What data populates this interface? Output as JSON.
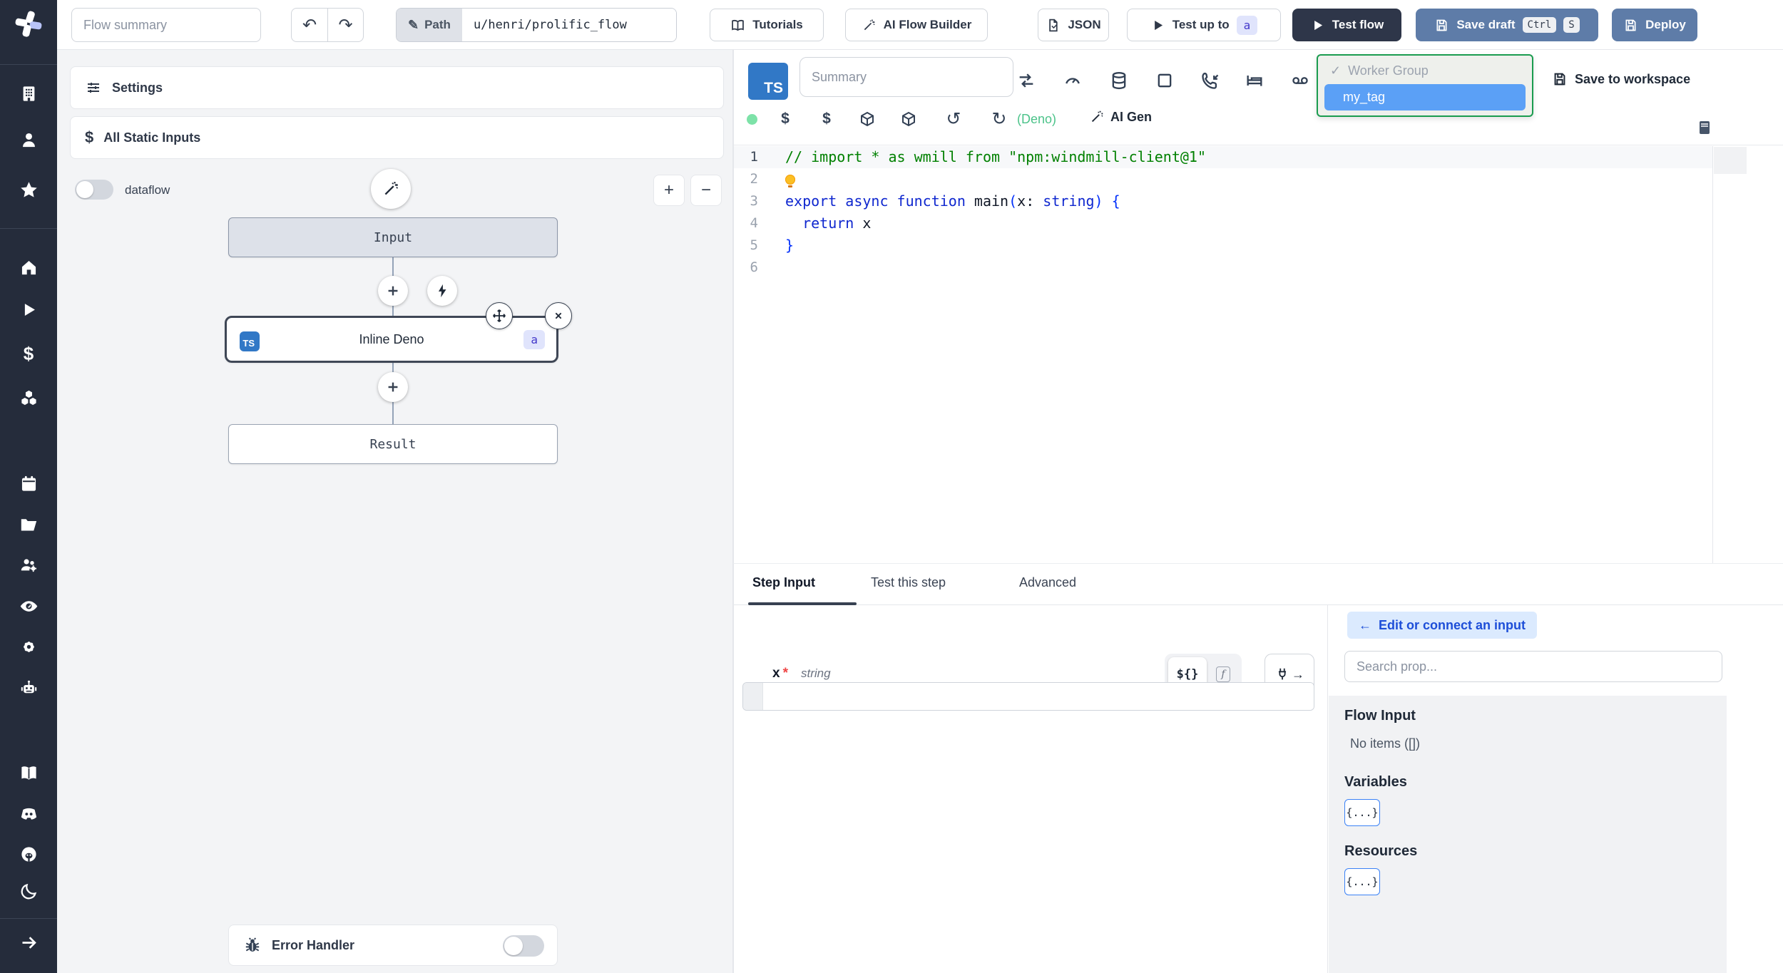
{
  "topbar": {
    "flow_summary_placeholder": "Flow summary",
    "undo_icon": "undo-arrow",
    "redo_icon": "redo-arrow",
    "path_label": "Path",
    "path_value": "u/henri/prolific_flow",
    "tutorials_label": "Tutorials",
    "ai_flow_builder_label": "AI Flow Builder",
    "json_label": "JSON",
    "test_up_to_label": "Test up to",
    "test_up_to_badge": "a",
    "test_flow_label": "Test flow",
    "save_draft_label": "Save draft",
    "save_draft_kbd": [
      "Ctrl",
      "S"
    ],
    "deploy_label": "Deploy"
  },
  "sidebar": {
    "icons": [
      "windmill-logo",
      "building",
      "user",
      "star",
      "home",
      "play",
      "dollar",
      "cubes",
      "calendar",
      "folder",
      "users-settings",
      "eye",
      "gear",
      "robot",
      "book",
      "discord",
      "github",
      "moon",
      "arrow-right"
    ]
  },
  "flow_panel": {
    "settings_label": "Settings",
    "all_static_inputs_label": "All Static Inputs",
    "dataflow_label": "dataflow",
    "dataflow_on": false,
    "zoom_in": "+",
    "zoom_out": "−",
    "graph": {
      "input_node": "Input",
      "step_node": "Inline Deno",
      "step_lang_badge": "TS",
      "step_id_badge": "a",
      "result_node": "Result"
    },
    "error_handler_label": "Error Handler",
    "error_handler_on": false
  },
  "editor": {
    "lang_badge": "TS",
    "summary_placeholder": "Summary",
    "toolbar_icons": [
      "retry",
      "concurrency-gauge",
      "cache-database",
      "early-stop-square",
      "suspend-phone",
      "sleep-bed",
      "mock-pipe"
    ],
    "status_dot_color": "#7de2a8",
    "second_row_icons": [
      "path-dollar",
      "variable-dollar",
      "package",
      "package",
      "history",
      "reload"
    ],
    "deno_label": "(Deno)",
    "deno_color": "#4cc38a",
    "ai_gen_label": "AI Gen",
    "worker_group": {
      "check": "✓",
      "header": "Worker Group",
      "selected": "my_tag",
      "selected_bg": "#5ba0f6",
      "border": "#1a9c4f"
    },
    "save_to_workspace_label": "Save to workspace",
    "code": {
      "lines": [
        {
          "n": "1",
          "active": true,
          "tokens": [
            {
              "t": "// import * as wmill from \"npm:windmill-client@1\"",
              "c": "cmt"
            }
          ]
        },
        {
          "n": "2",
          "tokens": [
            {
              "c": "bulb"
            }
          ]
        },
        {
          "n": "3",
          "tokens": [
            {
              "t": "export ",
              "c": "kw"
            },
            {
              "t": "async ",
              "c": "kw"
            },
            {
              "t": "function ",
              "c": "kw"
            },
            {
              "t": "main",
              "c": "fn"
            },
            {
              "t": "(",
              "c": "br"
            },
            {
              "t": "x",
              "c": "pm"
            },
            {
              "t": ": ",
              "c": "pl"
            },
            {
              "t": "string",
              "c": "kw"
            },
            {
              "t": ")",
              "c": "br"
            },
            {
              "t": " {",
              "c": "br"
            }
          ]
        },
        {
          "n": "4",
          "tokens": [
            {
              "t": "  ",
              "c": "pl"
            },
            {
              "t": "return",
              "c": "kw"
            },
            {
              "t": " x",
              "c": "pl"
            }
          ]
        },
        {
          "n": "5",
          "tokens": [
            {
              "t": "}",
              "c": "br"
            }
          ]
        },
        {
          "n": "6",
          "tokens": []
        }
      ]
    }
  },
  "bottom": {
    "tabs": [
      {
        "label": "Step Input",
        "active": true
      },
      {
        "label": "Test this step",
        "active": false
      },
      {
        "label": "Advanced",
        "active": false
      }
    ],
    "field": {
      "name": "x",
      "required_mark": "*",
      "type": "string",
      "value": ""
    },
    "expr_toggle_label": "${}",
    "fn_toggle_label": "f",
    "plug_arrow": "→",
    "picker": {
      "back_arrow": "←",
      "edit_connect_label": "Edit or connect an input",
      "search_placeholder": "Search prop...",
      "flow_input_label": "Flow Input",
      "no_items_label": "No items ([])",
      "variables_label": "Variables",
      "resources_label": "Resources",
      "braces_chip": "{...}"
    }
  }
}
